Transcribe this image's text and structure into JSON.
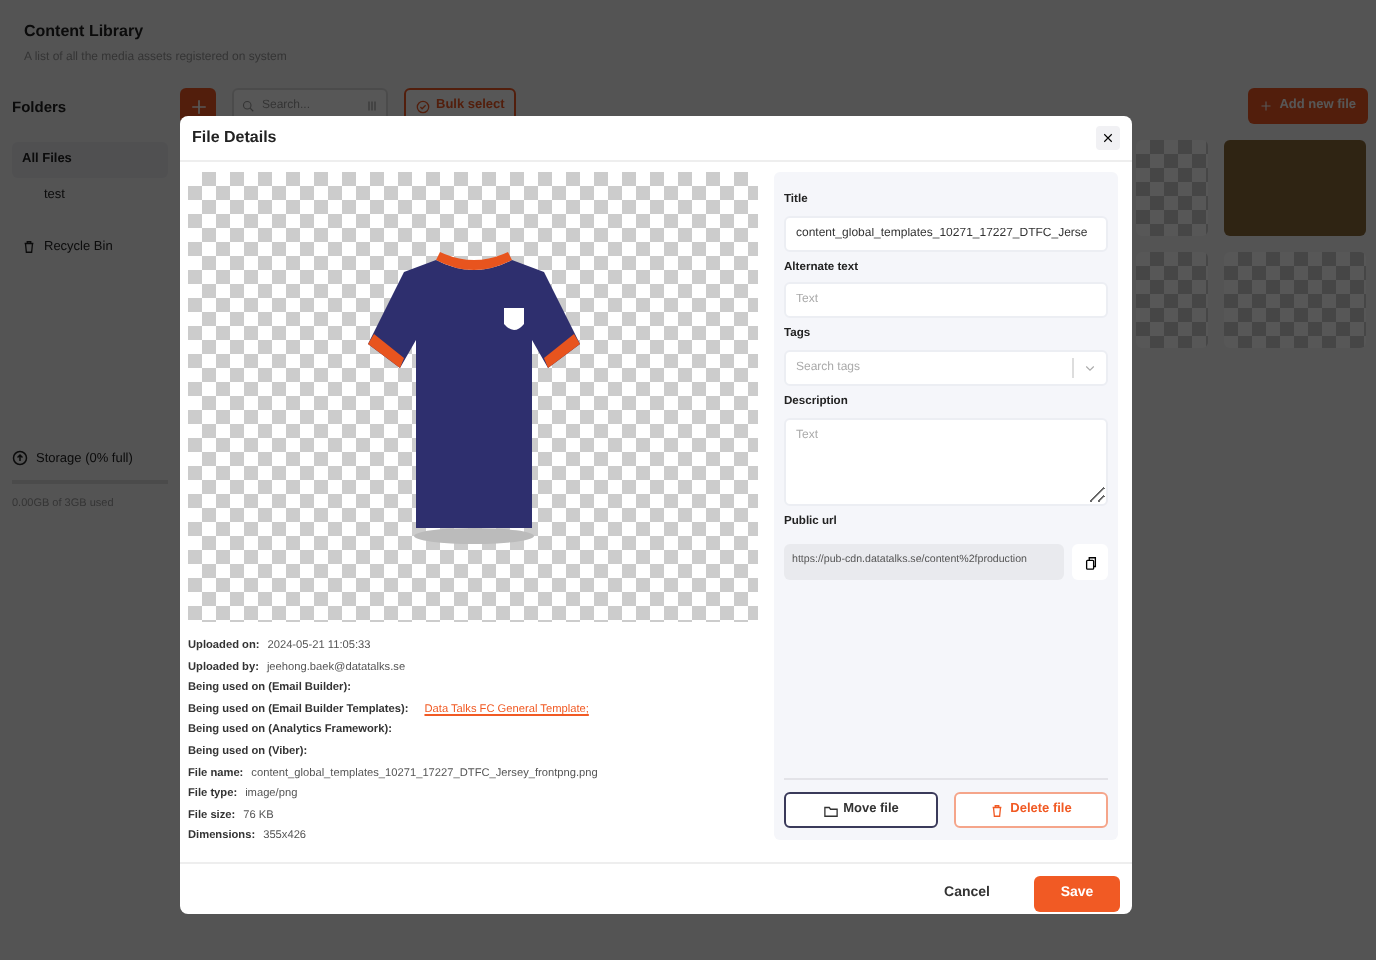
{
  "page": {
    "title": "Content Library",
    "subtitle": "A list of all the media assets registered on system"
  },
  "sidebar": {
    "heading": "Folders",
    "items": [
      {
        "label": "All Files",
        "kind": "folder",
        "selected": true
      },
      {
        "label": "test",
        "kind": "subfolder",
        "selected": false
      },
      {
        "label": "Recycle Bin",
        "kind": "bin",
        "selected": false
      }
    ],
    "storage": {
      "label": "Storage (0% full)",
      "level": 0,
      "usage": "0.00GB of 3GB used"
    }
  },
  "toolbar": {
    "search_placeholder": "Search...",
    "bulk_select": "Bulk select",
    "add_new_file": "Add new file"
  },
  "modal": {
    "title": "File Details",
    "details": [
      {
        "label": "Uploaded on:",
        "value": "2024-05-21 11:05:33",
        "kind": "text"
      },
      {
        "label": "Uploaded by:",
        "value": "jeehong.baek@datatalks.se",
        "kind": "text"
      },
      {
        "label": "Being used on (Email Builder):",
        "kind": "text"
      },
      {
        "label": "Being used on (Email Builder Templates):",
        "value": "Data Talks FC General Template;",
        "kind": "link"
      },
      {
        "label": "Being used on (Analytics Framework):",
        "kind": "text"
      },
      {
        "label": "Being used on (Viber):",
        "kind": "text"
      },
      {
        "label": "File name:",
        "value": "content_global_templates_10271_17227_DTFC_Jersey_frontpng.png",
        "kind": "text"
      },
      {
        "label": "File type:",
        "value": "image/png",
        "kind": "text"
      },
      {
        "label": "File size:",
        "value": "76 KB",
        "kind": "text"
      },
      {
        "label": "Dimensions:",
        "value": "355x426",
        "kind": "text"
      }
    ],
    "fields": [
      {
        "label": "Title",
        "kind": "input",
        "value": "content_global_templates_10271_17227_DTFC_Jerse"
      },
      {
        "label": "Alternate text",
        "kind": "input",
        "placeholder": "Text"
      },
      {
        "label": "Tags",
        "kind": "select",
        "placeholder": "Search tags"
      },
      {
        "label": "Description",
        "kind": "textarea",
        "placeholder": "Text"
      },
      {
        "label": "Public url",
        "kind": "url",
        "value": "https://pub-cdn.datatalks.se/content%2fproduction"
      }
    ],
    "move_file": "Move file",
    "delete_file": "Delete file",
    "cancel": "Cancel",
    "save": "Save"
  }
}
